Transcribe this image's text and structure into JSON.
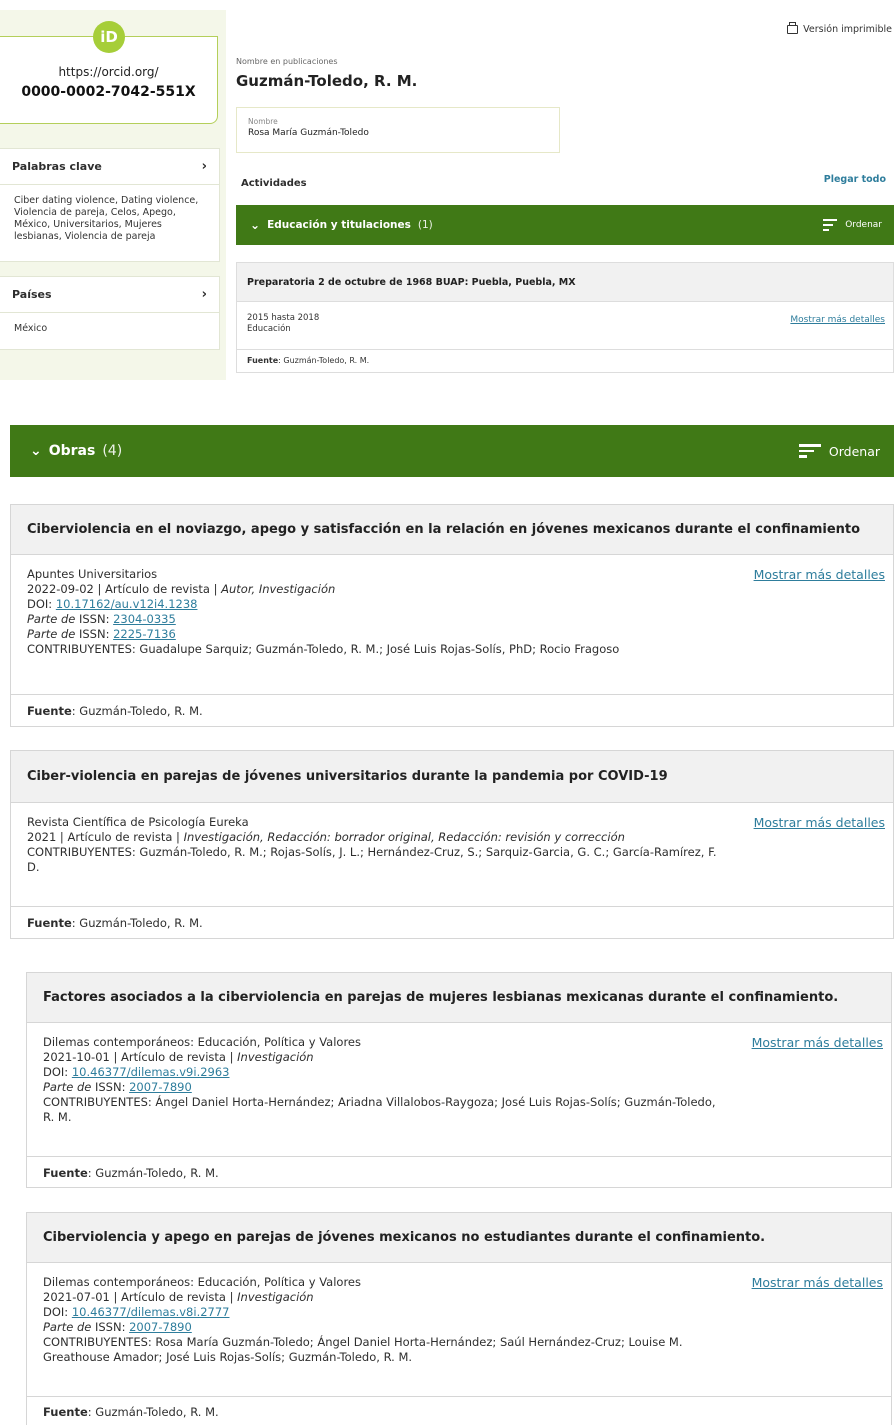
{
  "sidebar": {
    "orcid_logo": "iD",
    "orcid_url": "https://orcid.org/",
    "orcid_id": "0000-0002-7042-551X",
    "keywords_title": "Palabras clave",
    "keywords_text": "Ciber dating violence, Dating violence, Violencia de pareja, Celos, Apego, México, Universitarios, Mujeres lesbianas, Violencia de pareja",
    "countries_title": "Países",
    "countries_text": "México",
    "chevron": "›"
  },
  "header": {
    "print_label": "Versión imprimible",
    "name_small_label": "Nombre en publicaciones",
    "name_big": "Guzmán-Toledo, R. M.",
    "nombre_label": "Nombre",
    "nombre_value": "Rosa María Guzmán-Toledo"
  },
  "activities": {
    "title": "Actividades",
    "collapse_all": "Plegar todo"
  },
  "education": {
    "caret": "⌄",
    "title": "Educación y titulaciones",
    "count": "(1)",
    "sort_label": "Ordenar",
    "item": {
      "title": "Preparatoria 2 de octubre de 1968 BUAP: Puebla, Puebla, MX",
      "dates": "2015 hasta 2018",
      "type": "Educación",
      "more": "Mostrar más detalles",
      "source_label": "Fuente",
      "source_value": ": Guzmán-Toledo, R. M."
    }
  },
  "works": {
    "caret": "⌄",
    "title": "Obras",
    "count": "(4)",
    "sort_label": "Ordenar",
    "more": "Mostrar más detalles",
    "source_label": "Fuente",
    "source_value": ": Guzmán-Toledo, R. M.",
    "doi_label": "DOI: ",
    "part_of": "Parte de",
    "issn_label": " ISSN: ",
    "items": [
      {
        "title": "Ciberviolencia en el noviazgo, apego y satisfacción en la relación en jóvenes mexicanos durante el confinamiento",
        "journal": "Apuntes Universitarios",
        "meta": "2022-09-02 | Artículo de revista | ",
        "roles": "Autor, Investigación",
        "doi": "10.17162/au.v12i4.1238",
        "issn1": "2304-0335",
        "issn2": "2225-7136",
        "contributors": "CONTRIBUYENTES: Guadalupe Sarquiz; Guzmán-Toledo, R. M.; José Luis Rojas-Solís, PhD; Rocio Fragoso"
      },
      {
        "title": "Ciber-violencia en parejas de jóvenes universitarios durante la pandemia por COVID-19",
        "journal": "Revista Científica de Psicología Eureka",
        "meta": "2021 | Artículo de revista | ",
        "roles": "Investigación, Redacción: borrador original, Redacción: revisión y corrección",
        "contributors": "CONTRIBUYENTES: Guzmán-Toledo, R. M.; Rojas-Solís, J. L.; Hernández-Cruz, S.; Sarquiz-Garcia, G. C.; García-Ramírez, F. D."
      },
      {
        "title": "Factores asociados a la ciberviolencia en parejas de mujeres lesbianas mexicanas durante el confinamiento.",
        "journal": "Dilemas contemporáneos: Educación, Política y Valores",
        "meta": "2021-10-01 | Artículo de revista | ",
        "roles": "Investigación",
        "doi": "10.46377/dilemas.v9i.2963",
        "issn1": "2007-7890",
        "contributors": "CONTRIBUYENTES: Ángel Daniel Horta-Hernández; Ariadna Villalobos-Raygoza; José Luis Rojas-Solís; Guzmán-Toledo, R. M."
      },
      {
        "title": "Ciberviolencia y apego en parejas de jóvenes mexicanos no estudiantes durante el confinamiento.",
        "journal": "Dilemas contemporáneos: Educación, Política y Valores",
        "meta": "2021-07-01 | Artículo de revista | ",
        "roles": "Investigación",
        "doi": "10.46377/dilemas.v8i.2777",
        "issn1": "2007-7890",
        "contributors": "CONTRIBUYENTES: Rosa María Guzmán-Toledo; Ángel Daniel Horta-Hernández; Saúl Hernández-Cruz; Louise M. Greathouse Amador; José Luis Rojas-Solís; Guzmán-Toledo, R. M."
      }
    ]
  }
}
